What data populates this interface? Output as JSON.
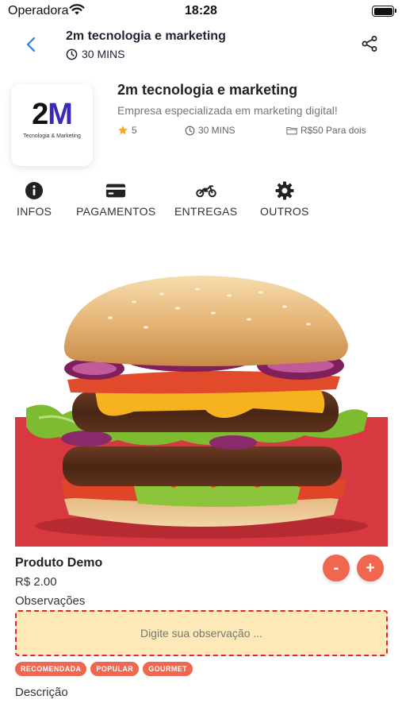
{
  "status_bar": {
    "carrier": "Operadora",
    "time": "18:28"
  },
  "nav": {
    "title": "2m tecnologia e marketing",
    "time": "30 MINS"
  },
  "store": {
    "logo_text": "2M",
    "logo_tagline": "Tecnologia & Marketing",
    "name": "2m tecnologia e marketing",
    "description": "Empresa especializada em marketing digital!",
    "rating": "5",
    "time": "30 MINS",
    "price": "R$50 Para dois"
  },
  "tabs": [
    {
      "label": "INFOS",
      "icon": "info-icon"
    },
    {
      "label": "PAGAMENTOS",
      "icon": "credit-card-icon"
    },
    {
      "label": "ENTREGAS",
      "icon": "motorcycle-icon"
    },
    {
      "label": "OUTROS",
      "icon": "gear-icon"
    }
  ],
  "product": {
    "name": "Produto Demo",
    "price": "R$ 2.00",
    "observations_label": "Observações",
    "observation_placeholder": "Digite sua observação ...",
    "decrement_label": "-",
    "increment_label": "+",
    "tags": [
      "RECOMENDADA",
      "POPULAR",
      "GOURMET"
    ],
    "description_label": "Descrição"
  },
  "colors": {
    "accent": "#f0664e",
    "link": "#2b7de9",
    "star": "#f5a623",
    "observation_bg": "#fde8b8",
    "observation_border": "#e0262e",
    "hero_bg": "#d8383f"
  }
}
